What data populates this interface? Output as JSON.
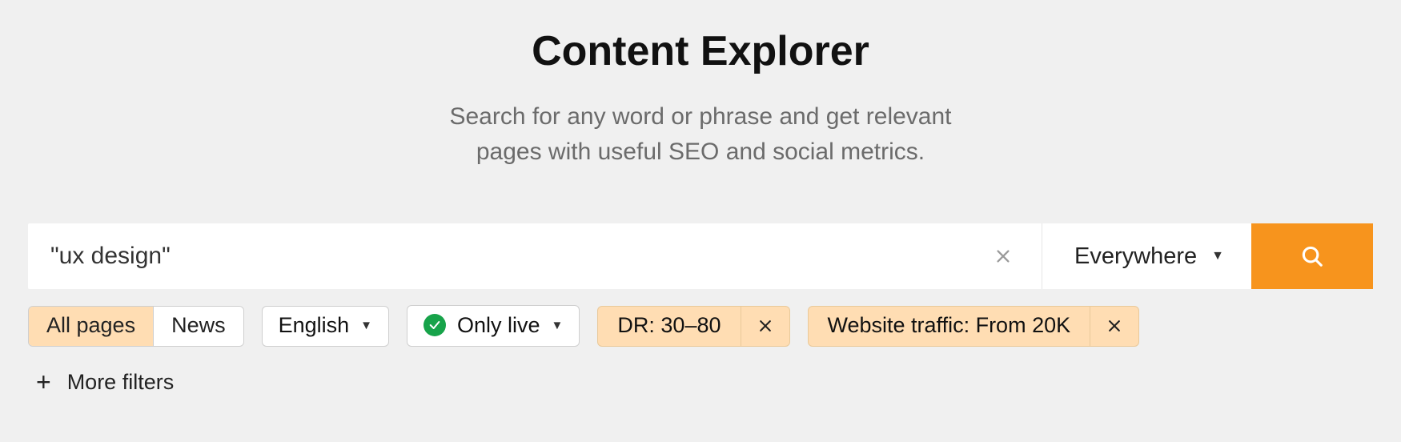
{
  "header": {
    "title": "Content Explorer",
    "subtitle_line1": "Search for any word or phrase and get relevant",
    "subtitle_line2": "pages with useful SEO and social metrics."
  },
  "search": {
    "value": "\"ux design\"",
    "scope_selected": "Everywhere"
  },
  "filters": {
    "segments": [
      {
        "label": "All pages",
        "active": true
      },
      {
        "label": "News",
        "active": false
      }
    ],
    "language": {
      "label": "English"
    },
    "live": {
      "label": "Only live",
      "checked": true
    },
    "chips": [
      {
        "label": "DR: 30–80"
      },
      {
        "label": "Website traffic: From 20K"
      }
    ],
    "more_label": "More filters"
  },
  "colors": {
    "accent": "#f7941d",
    "chip_bg": "#ffddb3",
    "success": "#17a34a"
  }
}
